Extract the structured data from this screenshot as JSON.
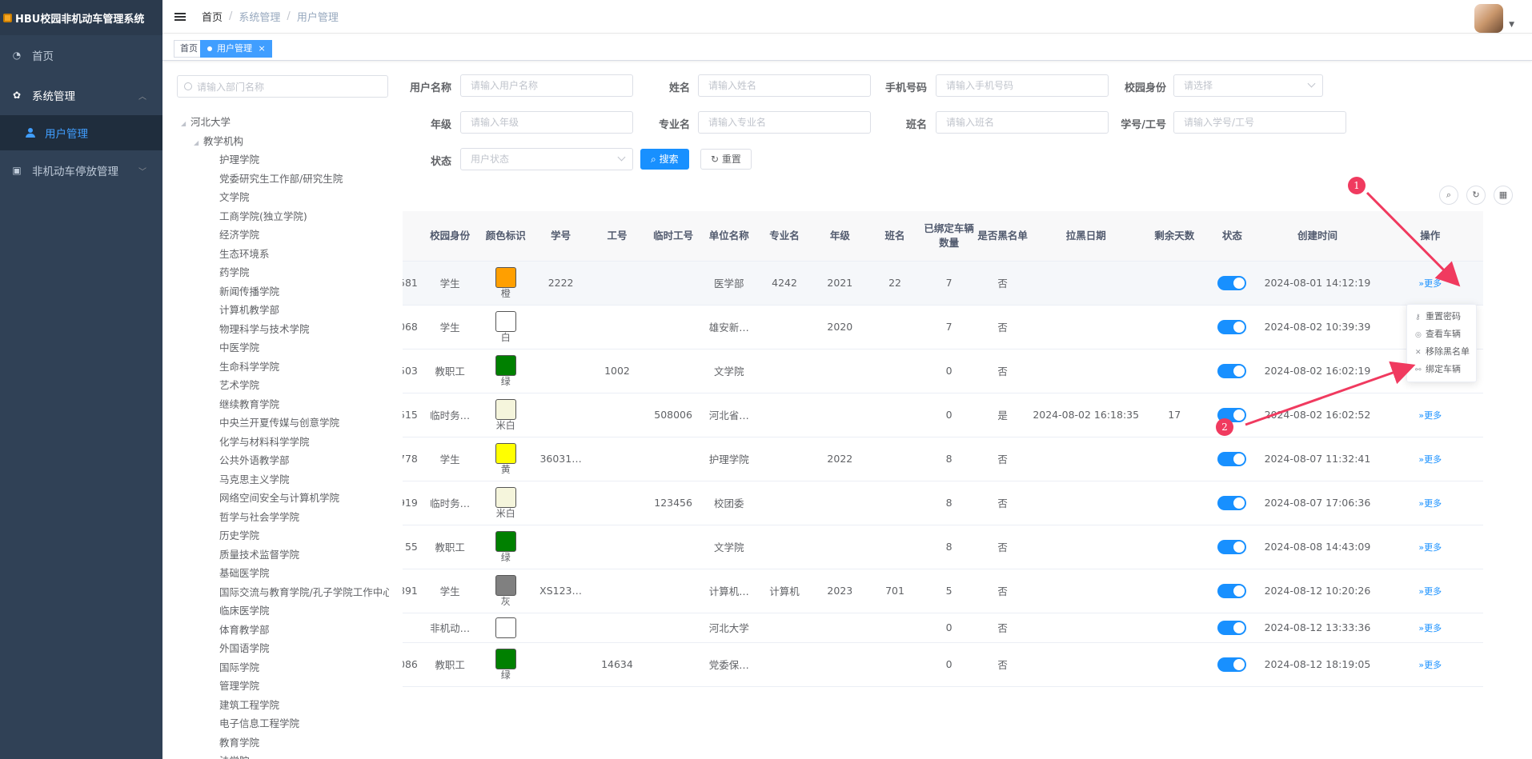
{
  "app": {
    "title": "HBU校园非机动车管理系统"
  },
  "sidebar": {
    "items": [
      {
        "label": "首页",
        "icon": "dashboard-icon"
      },
      {
        "label": "系统管理",
        "icon": "gear-icon",
        "children": [
          {
            "label": "用户管理",
            "icon": "user-icon"
          }
        ]
      },
      {
        "label": "非机动车停放管理",
        "icon": "monitor-icon"
      }
    ]
  },
  "header": {
    "breadcrumb": [
      "首页",
      "系统管理",
      "用户管理"
    ]
  },
  "tags": [
    {
      "label": "首页"
    },
    {
      "label": "用户管理",
      "close": "×"
    }
  ],
  "dept_search": {
    "placeholder": "请输入部门名称"
  },
  "tree": {
    "root": "河北大学",
    "group": "教学机构",
    "children": [
      "护理学院",
      "党委研究生工作部/研究生院",
      "文学院",
      "工商学院(独立学院)",
      "经济学院",
      "生态环境系",
      "药学院",
      "新闻传播学院",
      "计算机教学部",
      "物理科学与技术学院",
      "中医学院",
      "生命科学学院",
      "艺术学院",
      "继续教育学院",
      "中央兰开夏传媒与创意学院",
      "化学与材料科学学院",
      "公共外语教学部",
      "马克思主义学院",
      "网络空间安全与计算机学院",
      "哲学与社会学学院",
      "历史学院",
      "质量技术监督学院",
      "基础医学院",
      "国际交流与教育学院/孔子学院工作中心",
      "临床医学院",
      "体育教学部",
      "外国语学院",
      "国际学院",
      "管理学院",
      "建筑工程学院",
      "电子信息工程学院",
      "教育学院",
      "法学院"
    ]
  },
  "form": {
    "username": {
      "label": "用户名称",
      "placeholder": "请输入用户名称"
    },
    "name": {
      "label": "姓名",
      "placeholder": "请输入姓名"
    },
    "phone": {
      "label": "手机号码",
      "placeholder": "请输入手机号码"
    },
    "identity": {
      "label": "校园身份",
      "placeholder": "请选择"
    },
    "grade": {
      "label": "年级",
      "placeholder": "请输入年级"
    },
    "major": {
      "label": "专业名",
      "placeholder": "请输入专业名"
    },
    "class": {
      "label": "班名",
      "placeholder": "请输入班名"
    },
    "stuno": {
      "label": "学号/工号",
      "placeholder": "请输入学号/工号"
    },
    "status": {
      "label": "状态",
      "placeholder": "用户状态"
    },
    "search_btn": "搜索",
    "reset_btn": "重置"
  },
  "table": {
    "headers": [
      "",
      "校园身份",
      "颜色标识",
      "学号",
      "工号",
      "临时工号",
      "单位名称",
      "专业名",
      "年级",
      "班名",
      "已绑定车辆数量",
      "是否黑名单",
      "拉黑日期",
      "剩余天数",
      "状态",
      "创建时间",
      "操作"
    ],
    "rows": [
      {
        "id": "581",
        "identity": "学生",
        "color": "#ff9f00",
        "color_label": "橙",
        "stuno": "2222",
        "workno": "",
        "tempno": "",
        "unit": "医学部",
        "major": "4242",
        "grade": "2021",
        "class": "22",
        "bikes": "7",
        "black": "否",
        "black_date": "",
        "days": "",
        "created": "2024-08-01 14:12:19",
        "more": "更多"
      },
      {
        "id": "068",
        "identity": "学生",
        "color": "#ffffff",
        "color_label": "白",
        "stuno": "",
        "workno": "",
        "tempno": "",
        "unit": "雄安新…",
        "major": "",
        "grade": "2020",
        "class": "",
        "bikes": "7",
        "black": "否",
        "black_date": "",
        "days": "",
        "created": "2024-08-02 10:39:39",
        "more": "更多"
      },
      {
        "id": "503",
        "identity": "教职工",
        "color": "#008000",
        "color_label": "绿",
        "stuno": "",
        "workno": "1002",
        "tempno": "",
        "unit": "文学院",
        "major": "",
        "grade": "",
        "class": "",
        "bikes": "0",
        "black": "否",
        "black_date": "",
        "days": "",
        "created": "2024-08-02 16:02:19",
        "more": "更多"
      },
      {
        "id": "515",
        "identity": "临时务…",
        "color": "#f5f5dc",
        "color_label": "米白",
        "stuno": "",
        "workno": "",
        "tempno": "508006",
        "unit": "河北省…",
        "major": "",
        "grade": "",
        "class": "",
        "bikes": "0",
        "black": "是",
        "black_date": "2024-08-02 16:18:35",
        "days": "17",
        "created": "2024-08-02 16:02:52",
        "more": "更多"
      },
      {
        "id": "778",
        "identity": "学生",
        "color": "#ffff00",
        "color_label": "黄",
        "stuno": "36031…",
        "workno": "",
        "tempno": "",
        "unit": "护理学院",
        "major": "",
        "grade": "2022",
        "class": "",
        "bikes": "8",
        "black": "否",
        "black_date": "",
        "days": "",
        "created": "2024-08-07 11:32:41",
        "more": "更多"
      },
      {
        "id": "919",
        "identity": "临时务…",
        "color": "#f5f5dc",
        "color_label": "米白",
        "stuno": "",
        "workno": "",
        "tempno": "123456",
        "unit": "校团委",
        "major": "",
        "grade": "",
        "class": "",
        "bikes": "8",
        "black": "否",
        "black_date": "",
        "days": "",
        "created": "2024-08-07 17:06:36",
        "more": "更多"
      },
      {
        "id": "55",
        "identity": "教职工",
        "color": "#008000",
        "color_label": "绿",
        "stuno": "",
        "workno": "",
        "tempno": "",
        "unit": "文学院",
        "major": "",
        "grade": "",
        "class": "",
        "bikes": "8",
        "black": "否",
        "black_date": "",
        "days": "",
        "created": "2024-08-08 14:43:09",
        "more": "更多"
      },
      {
        "id": "891",
        "identity": "学生",
        "color": "#808080",
        "color_label": "灰",
        "stuno": "XS123…",
        "workno": "",
        "tempno": "",
        "unit": "计算机…",
        "major": "计算机",
        "grade": "2023",
        "class": "701",
        "bikes": "5",
        "black": "否",
        "black_date": "",
        "days": "",
        "created": "2024-08-12 10:20:26",
        "more": "更多"
      },
      {
        "id": "",
        "identity": "非机动…",
        "color": "#ffffff",
        "color_label": "",
        "stuno": "",
        "workno": "",
        "tempno": "",
        "unit": "河北大学",
        "major": "",
        "grade": "",
        "class": "",
        "bikes": "0",
        "black": "否",
        "black_date": "",
        "days": "",
        "created": "2024-08-12 13:33:36",
        "more": "更多"
      },
      {
        "id": "086",
        "identity": "教职工",
        "color": "#008000",
        "color_label": "绿",
        "stuno": "",
        "workno": "14634",
        "tempno": "",
        "unit": "党委保…",
        "major": "",
        "grade": "",
        "class": "",
        "bikes": "0",
        "black": "否",
        "black_date": "",
        "days": "",
        "created": "2024-08-12 18:19:05",
        "more": "更多"
      }
    ]
  },
  "dropdown": {
    "items": [
      {
        "label": "重置密码",
        "icon": "key-icon"
      },
      {
        "label": "查看车辆",
        "icon": "eye-icon"
      },
      {
        "label": "移除黑名单",
        "icon": "close-icon"
      },
      {
        "label": "绑定车辆",
        "icon": "link-icon"
      }
    ]
  },
  "annotations": [
    {
      "label": "1"
    },
    {
      "label": "2"
    }
  ]
}
